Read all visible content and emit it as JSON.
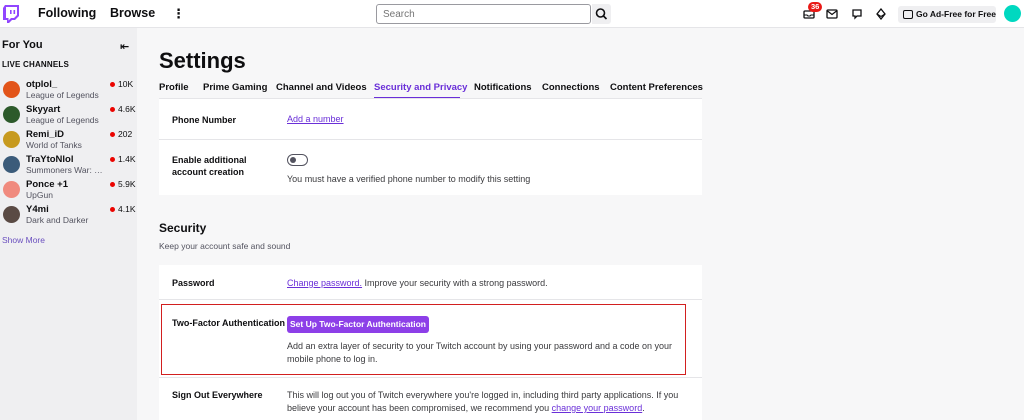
{
  "nav": {
    "following": "Following",
    "browse": "Browse",
    "search_placeholder": "Search",
    "notification_count": "36",
    "ad_free": "Go Ad-Free for Free"
  },
  "sidebar": {
    "for_you": "For You",
    "live_channels": "LIVE CHANNELS",
    "channels": [
      {
        "name": "otplol_",
        "game": "League of Legends",
        "viewers": "10K",
        "color": "#e2541a"
      },
      {
        "name": "Skyyart",
        "game": "League of Legends",
        "viewers": "4.6K",
        "color": "#2d5a2b"
      },
      {
        "name": "Remi_iD",
        "game": "World of Tanks",
        "viewers": "202",
        "color": "#c79a1f"
      },
      {
        "name": "TraYtoNlol",
        "game": "Summoners War: S...",
        "viewers": "1.4K",
        "color": "#3b5b7a"
      },
      {
        "name": "Ponce +1",
        "game": "UpGun",
        "viewers": "5.9K",
        "color": "#f08a7e"
      },
      {
        "name": "Y4mi",
        "game": "Dark and Darker",
        "viewers": "4.1K",
        "color": "#5a4a44"
      }
    ],
    "show_more": "Show More"
  },
  "page": {
    "title": "Settings",
    "tabs": [
      {
        "label": "Profile"
      },
      {
        "label": "Prime Gaming"
      },
      {
        "label": "Channel and Videos"
      },
      {
        "label": "Security and Privacy"
      },
      {
        "label": "Notifications"
      },
      {
        "label": "Connections"
      },
      {
        "label": "Content Preferences"
      }
    ],
    "active_tab": "Security and Privacy"
  },
  "contact": {
    "phone_label": "Phone Number",
    "phone_link": "Add a number",
    "additional_label": "Enable additional account creation",
    "additional_note": "You must have a verified phone number to modify this setting",
    "toggle_on": false
  },
  "security": {
    "title": "Security",
    "subtitle": "Keep your account safe and sound",
    "password_label": "Password",
    "password_link": "Change password.",
    "password_desc": " Improve your security with a strong password.",
    "twofa_label": "Two-Factor Authentication",
    "twofa_button": "Set Up Two-Factor Authentication",
    "twofa_desc": "Add an extra layer of security to your Twitch account by using your password and a code on your mobile phone to log in.",
    "signout_label": "Sign Out Everywhere",
    "signout_desc": "This will log out you of Twitch everywhere you're logged in, including third party applications. If you believe your account has been compromised, we recommend you ",
    "signout_link": "change your password",
    "signout_end": "."
  }
}
